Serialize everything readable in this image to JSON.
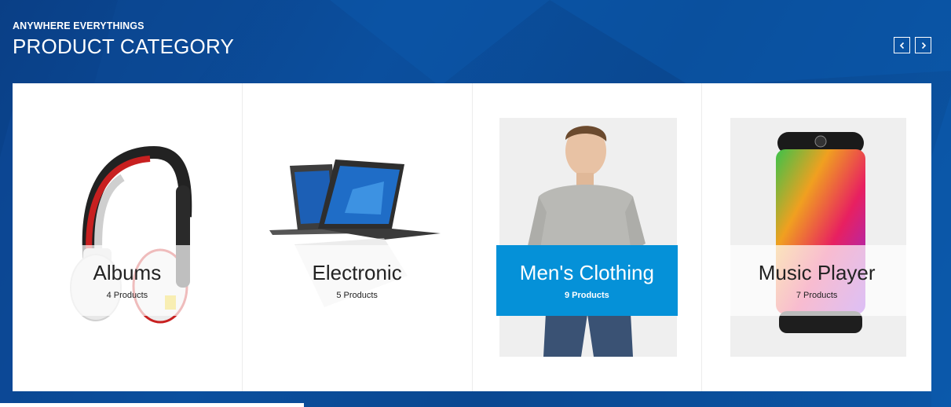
{
  "header": {
    "subtitle": "ANYWHERE EVERYTHINGS",
    "title": "PRODUCT CATEGORY"
  },
  "navigation": {
    "prev_icon": "chevron-left-icon",
    "next_icon": "chevron-right-icon"
  },
  "categories": [
    {
      "name": "Albums",
      "count": "4 Products",
      "image": "headphones"
    },
    {
      "name": "Electronic",
      "count": "5 Products",
      "image": "laptop"
    },
    {
      "name": "Men's Clothing",
      "count": "9 Products",
      "image": "man-in-sweater",
      "active": true
    },
    {
      "name": "Music Player",
      "count": "7 Products",
      "image": "speaker"
    }
  ],
  "colors": {
    "background": "#0b4f9e",
    "active_overlay": "#0591d8",
    "panel": "#ffffff"
  }
}
